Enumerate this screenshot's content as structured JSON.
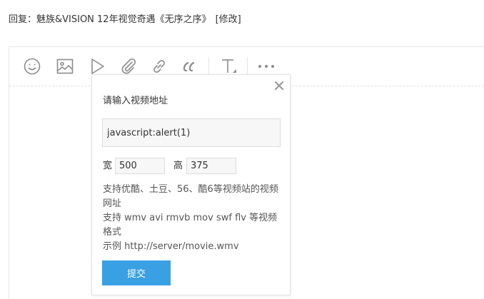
{
  "reply": {
    "text": "回复：魅族&VISION 12年视觉奇遇《无序之序》",
    "edit_label": "[修改]"
  },
  "toolbar": {
    "icons": [
      "smiley-icon",
      "image-icon",
      "video-play-icon",
      "attachment-icon",
      "link-icon",
      "quote-icon",
      "text-format-icon",
      "more-icon"
    ]
  },
  "video_popup": {
    "title": "请输入视频地址",
    "url_value": "javascript:alert(1)",
    "width_label": "宽",
    "width_value": "500",
    "height_label": "高",
    "height_value": "375",
    "hint_line1": "支持优酷、土豆、56、酷6等视频站的视频网址",
    "hint_line2": "支持 wmv avi rmvb mov swf flv 等视频格式",
    "hint_line3": "示例 http://server/movie.wmv",
    "submit_label": "提交"
  },
  "colors": {
    "submit_button": "#3aa0e4",
    "icon_gray": "#8c8c8c",
    "border": "#e3e3e3"
  }
}
